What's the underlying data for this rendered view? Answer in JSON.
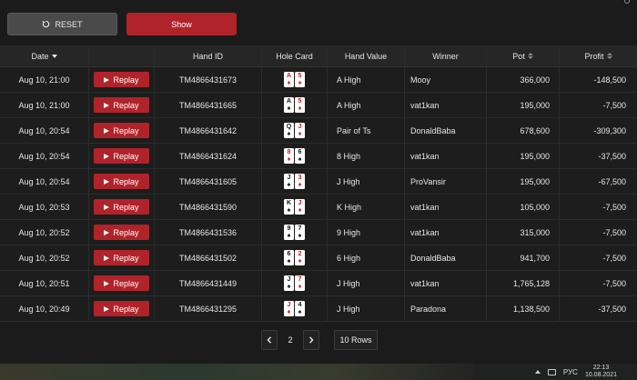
{
  "toolbar": {
    "reset_label": "RESET",
    "show_label": "Show"
  },
  "table": {
    "headers": {
      "date": "Date",
      "hand_id": "Hand ID",
      "hole_card": "Hole Card",
      "hand_value": "Hand Value",
      "winner": "Winner",
      "pot": "Pot",
      "profit": "Profit"
    },
    "replay_label": "Replay",
    "rows": [
      {
        "date": "Aug 10, 21:00",
        "hand_id": "TM4866431673",
        "cards": [
          {
            "rank": "A",
            "suit": "♦",
            "color": "#d11"
          },
          {
            "rank": "5",
            "suit": "♦",
            "color": "#d11"
          }
        ],
        "hand_value": "A High",
        "winner": "Mooy",
        "pot": "366,000",
        "profit": "-148,500"
      },
      {
        "date": "Aug 10, 21:00",
        "hand_id": "TM4866431665",
        "cards": [
          {
            "rank": "A",
            "suit": "♠",
            "color": "#111"
          },
          {
            "rank": "5",
            "suit": "♦",
            "color": "#d11"
          }
        ],
        "hand_value": "A High",
        "winner": "vat1kan",
        "pot": "195,000",
        "profit": "-7,500"
      },
      {
        "date": "Aug 10, 20:54",
        "hand_id": "TM4866431642",
        "cards": [
          {
            "rank": "Q",
            "suit": "♠",
            "color": "#111"
          },
          {
            "rank": "J",
            "suit": "♦",
            "color": "#d11"
          }
        ],
        "hand_value": "Pair of Ts",
        "winner": "DonaldBaba",
        "pot": "678,600",
        "profit": "-309,300"
      },
      {
        "date": "Aug 10, 20:54",
        "hand_id": "TM4866431624",
        "cards": [
          {
            "rank": "8",
            "suit": "♦",
            "color": "#d11"
          },
          {
            "rank": "6",
            "suit": "♠",
            "color": "#111"
          }
        ],
        "hand_value": "8 High",
        "winner": "vat1kan",
        "pot": "195,000",
        "profit": "-37,500"
      },
      {
        "date": "Aug 10, 20:54",
        "hand_id": "TM4866431605",
        "cards": [
          {
            "rank": "J",
            "suit": "♠",
            "color": "#111"
          },
          {
            "rank": "3",
            "suit": "♦",
            "color": "#d11"
          }
        ],
        "hand_value": "J High",
        "winner": "ProVansir",
        "pot": "195,000",
        "profit": "-67,500"
      },
      {
        "date": "Aug 10, 20:53",
        "hand_id": "TM4866431590",
        "cards": [
          {
            "rank": "K",
            "suit": "♠",
            "color": "#111"
          },
          {
            "rank": "J",
            "suit": "♦",
            "color": "#d11"
          }
        ],
        "hand_value": "K High",
        "winner": "vat1kan",
        "pot": "105,000",
        "profit": "-7,500"
      },
      {
        "date": "Aug 10, 20:52",
        "hand_id": "TM4866431536",
        "cards": [
          {
            "rank": "9",
            "suit": "♠",
            "color": "#111"
          },
          {
            "rank": "7",
            "suit": "♠",
            "color": "#111"
          }
        ],
        "hand_value": "9 High",
        "winner": "vat1kan",
        "pot": "315,000",
        "profit": "-7,500"
      },
      {
        "date": "Aug 10, 20:52",
        "hand_id": "TM4866431502",
        "cards": [
          {
            "rank": "6",
            "suit": "♠",
            "color": "#111"
          },
          {
            "rank": "2",
            "suit": "♦",
            "color": "#d11"
          }
        ],
        "hand_value": "6 High",
        "winner": "DonaldBaba",
        "pot": "941,700",
        "profit": "-7,500"
      },
      {
        "date": "Aug 10, 20:51",
        "hand_id": "TM4866431449",
        "cards": [
          {
            "rank": "J",
            "suit": "♠",
            "color": "#111"
          },
          {
            "rank": "7",
            "suit": "♦",
            "color": "#d11"
          }
        ],
        "hand_value": "J High",
        "winner": "vat1kan",
        "pot": "1,765,128",
        "profit": "-7,500"
      },
      {
        "date": "Aug 10, 20:49",
        "hand_id": "TM4866431295",
        "cards": [
          {
            "rank": "J",
            "suit": "♦",
            "color": "#d11"
          },
          {
            "rank": "4",
            "suit": "♠",
            "color": "#111"
          }
        ],
        "hand_value": "J High",
        "winner": "Paradona",
        "pot": "1,138,500",
        "profit": "-37,500"
      }
    ]
  },
  "pagination": {
    "page": "2",
    "rows_label": "10 Rows",
    "prev_icon": "chevron-left-icon",
    "next_icon": "chevron-right-icon"
  },
  "taskbar": {
    "language": "РУС",
    "time": "22:13",
    "date": "10.08.2021"
  },
  "colors": {
    "accent": "#b1232a",
    "background": "#1b1b1b",
    "header": "#262626"
  }
}
